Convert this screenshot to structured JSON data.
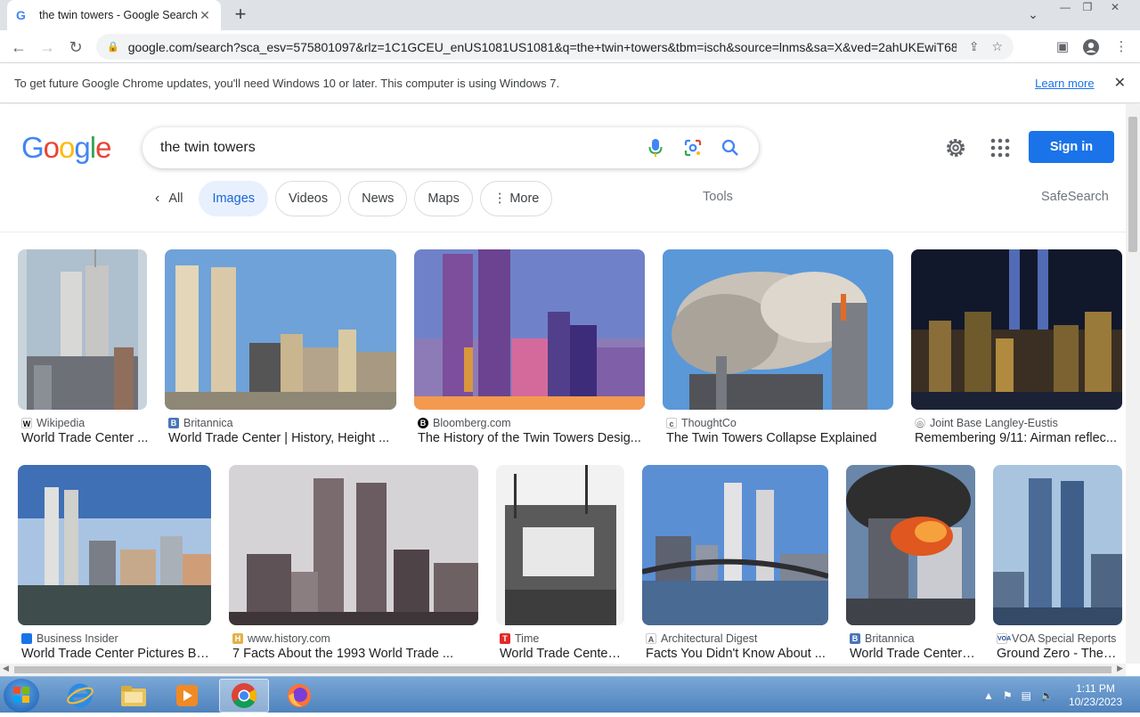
{
  "browser": {
    "tab_title": "the twin towers - Google Search",
    "url": "google.com/search?sca_esv=575801097&rlz=1C1GCEU_enUS1081US1081&q=the+twin+towers&tbm=isch&source=lnms&sa=X&ved=2ahUKEwiT68PprI..."
  },
  "infobar": {
    "message": "To get future Google Chrome updates, you'll need Windows 10 or later. This computer is using Windows 7.",
    "learn_more": "Learn more"
  },
  "search": {
    "query": "the twin towers",
    "sign_in": "Sign in",
    "logo": [
      "G",
      "o",
      "o",
      "g",
      "l",
      "e"
    ],
    "logo_colors": [
      "#4285F4",
      "#EA4335",
      "#FBBC05",
      "#4285F4",
      "#34A853",
      "#EA4335"
    ]
  },
  "chips": {
    "all": "All",
    "images": "Images",
    "videos": "Videos",
    "news": "News",
    "maps": "Maps",
    "more": "More",
    "tools": "Tools",
    "safesearch": "SafeSearch"
  },
  "results": [
    {
      "source": "Wikipedia",
      "title": "World Trade Center ..."
    },
    {
      "source": "Britannica",
      "title": "World Trade Center | History, Height ..."
    },
    {
      "source": "Bloomberg.com",
      "title": "The History of the Twin Towers Desig..."
    },
    {
      "source": "ThoughtCo",
      "title": "The Twin Towers Collapse Explained"
    },
    {
      "source": "Joint Base Langley-Eustis",
      "title": "Remembering 9/11: Airman reflec..."
    },
    {
      "source": "Business Insider",
      "title": "World Trade Center Pictures Be..."
    },
    {
      "source": "www.history.com",
      "title": "7 Facts About the 1993 World Trade ..."
    },
    {
      "source": "Time",
      "title": "World Trade Center ..."
    },
    {
      "source": "Architectural Digest",
      "title": "Facts You Didn't Know About ..."
    },
    {
      "source": "Britannica",
      "title": "World Trade Center ..."
    },
    {
      "source": "VOA Special Reports",
      "title": "Ground Zero - Then ..."
    }
  ],
  "taskbar": {
    "time": "1:11 PM",
    "date": "10/23/2023"
  },
  "colors": {
    "accent": "#1a73e8",
    "chip_active_bg": "#e8f0fe"
  }
}
